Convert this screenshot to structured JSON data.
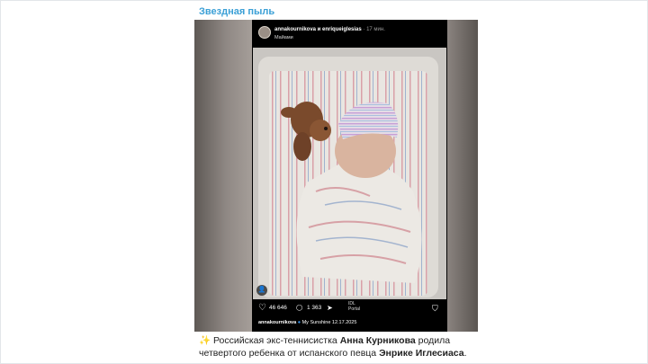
{
  "channel": {
    "name": "Звездная пыль"
  },
  "instagram": {
    "username_line": "annakournikova и enriqueiglesias",
    "time_ago": "· 17 мин.",
    "location": "Майами",
    "likes": "46 646",
    "comments": "1 363",
    "audio_label_1": "IDL",
    "audio_label_2": "Portal",
    "caption_user": "annakournikova",
    "caption_text": "My Sunshine 12.17.2025"
  },
  "post": {
    "emoji": "✨",
    "text_1": " Российская экс-теннисистка ",
    "name_1": "Анна Курникова",
    "text_2": " родила четвертого ребенка от испанского певца ",
    "name_2": "Энрике Иглесиаса",
    "text_3": "."
  },
  "colors": {
    "link": "#3a9fd6",
    "ig_bg": "#000000",
    "verified": "#3897f0"
  },
  "icons": [
    "heart-icon",
    "comment-icon",
    "send-icon",
    "bookmark-icon",
    "tagged-user-icon",
    "verified-icon"
  ]
}
